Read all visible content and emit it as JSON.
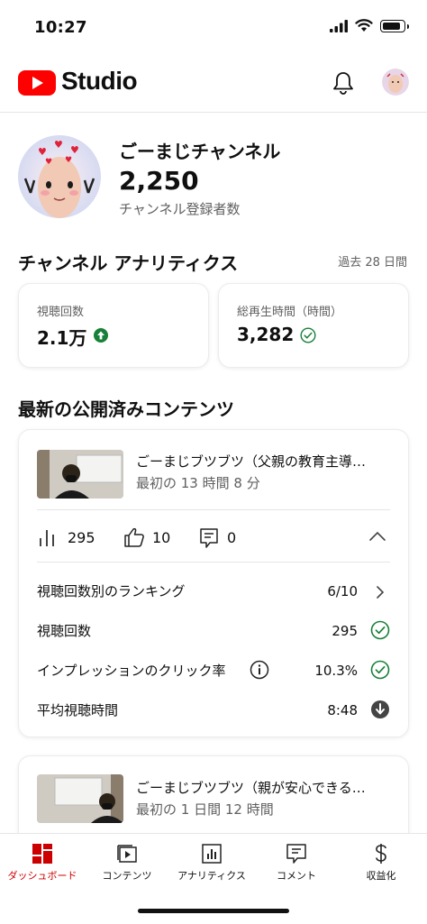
{
  "status_bar": {
    "time": "10:27"
  },
  "header": {
    "app_name": "Studio"
  },
  "channel": {
    "name": "ごーまじチャンネル",
    "subscribers": "2,250",
    "subscribers_label": "チャンネル登録者数"
  },
  "analytics": {
    "title": "チャンネル アナリティクス",
    "range": "過去 28 日間",
    "metrics": [
      {
        "label": "視聴回数",
        "value": "2.1万",
        "status": "up-arrow-icon"
      },
      {
        "label": "総再生時間（時間）",
        "value": "3,282",
        "status": "check-icon"
      }
    ]
  },
  "latest": {
    "title": "最新の公開済みコンテンツ",
    "videos": [
      {
        "title": "ごーまじブツブツ（父親の教育主導…",
        "subtitle": "最初の 13 時間 8 分",
        "views": "295",
        "likes": "10",
        "comments": "0",
        "rows": [
          {
            "label": "視聴回数別のランキング",
            "value": "6/10"
          },
          {
            "label": "視聴回数",
            "value": "295"
          },
          {
            "label": "インプレッションのクリック率",
            "value": "10.3%"
          },
          {
            "label": "平均視聴時間",
            "value": "8:48"
          }
        ]
      },
      {
        "title": "ごーまじブツブツ（親が安心できる…",
        "subtitle": "最初の 1 日間 12 時間"
      }
    ]
  },
  "nav": {
    "items": [
      {
        "label": "ダッシュボード",
        "active": true
      },
      {
        "label": "コンテンツ"
      },
      {
        "label": "アナリティクス"
      },
      {
        "label": "コメント"
      },
      {
        "label": "収益化"
      }
    ]
  },
  "colors": {
    "brand_red": "#ff0000",
    "active_nav": "#cc0000",
    "success_green": "#188038",
    "text_secondary": "#606060"
  }
}
